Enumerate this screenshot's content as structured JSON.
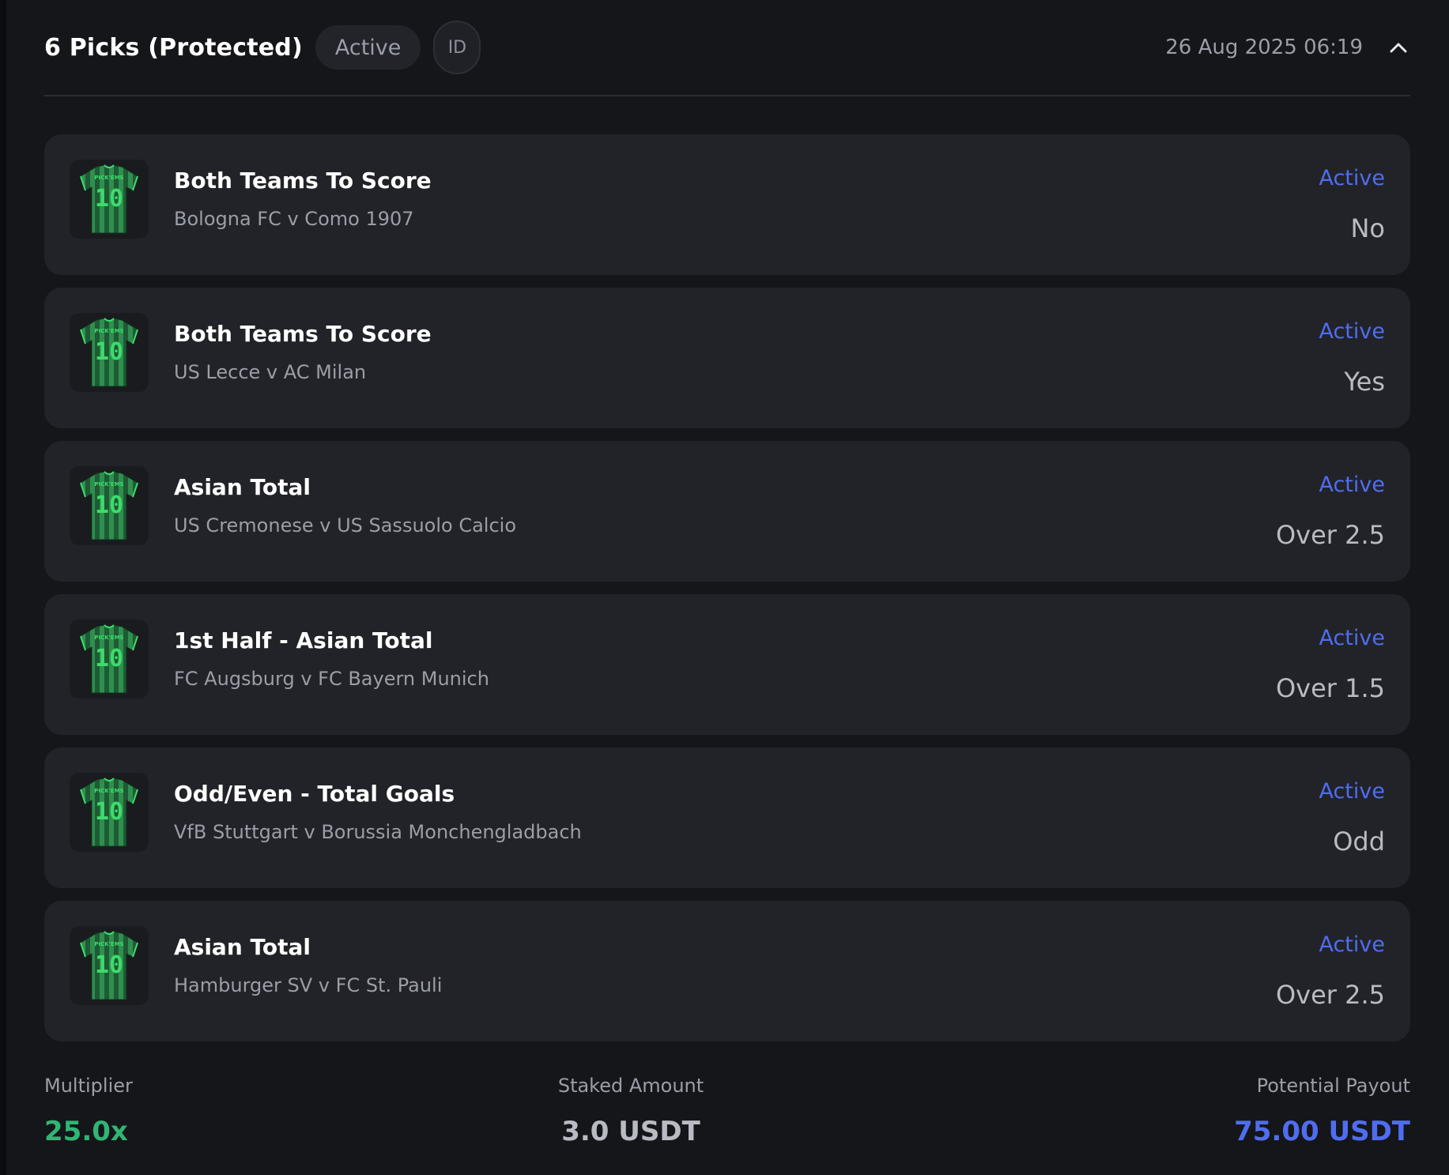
{
  "header": {
    "title": "6 Picks (Protected)",
    "status": "Active",
    "id_label": "ID",
    "date": "26 Aug 2025 06:19"
  },
  "jersey": {
    "brand": "PICK'EMS",
    "number": "10",
    "colors": {
      "body": "#1e5a34",
      "stripe": "#2f8f4f",
      "accent": "#3ddc6b"
    }
  },
  "picks": [
    {
      "market": "Both Teams To Score",
      "match": "Bologna FC v Como 1907",
      "status": "Active",
      "selection": "No"
    },
    {
      "market": "Both Teams To Score",
      "match": "US Lecce v AC Milan",
      "status": "Active",
      "selection": "Yes"
    },
    {
      "market": "Asian Total",
      "match": "US Cremonese v US Sassuolo Calcio",
      "status": "Active",
      "selection": "Over 2.5"
    },
    {
      "market": "1st Half - Asian Total",
      "match": "FC Augsburg v FC Bayern Munich",
      "status": "Active",
      "selection": "Over 1.5"
    },
    {
      "market": "Odd/Even - Total Goals",
      "match": "VfB Stuttgart v Borussia Monchengladbach",
      "status": "Active",
      "selection": "Odd"
    },
    {
      "market": "Asian Total",
      "match": "Hamburger SV v FC St. Pauli",
      "status": "Active",
      "selection": "Over 2.5"
    }
  ],
  "footer": {
    "multiplier_label": "Multiplier",
    "multiplier_value": "25.0x",
    "staked_label": "Staked Amount",
    "staked_value": "3.0 USDT",
    "payout_label": "Potential Payout",
    "payout_value": "75.00 USDT"
  },
  "colors": {
    "multiplier": "#2fb673",
    "staked": "#b8bbc2",
    "payout": "#4f6df0",
    "status_active": "#4f6df0"
  },
  "icons": {
    "collapse": "chevron-up-icon",
    "jersey": "jersey-icon"
  }
}
